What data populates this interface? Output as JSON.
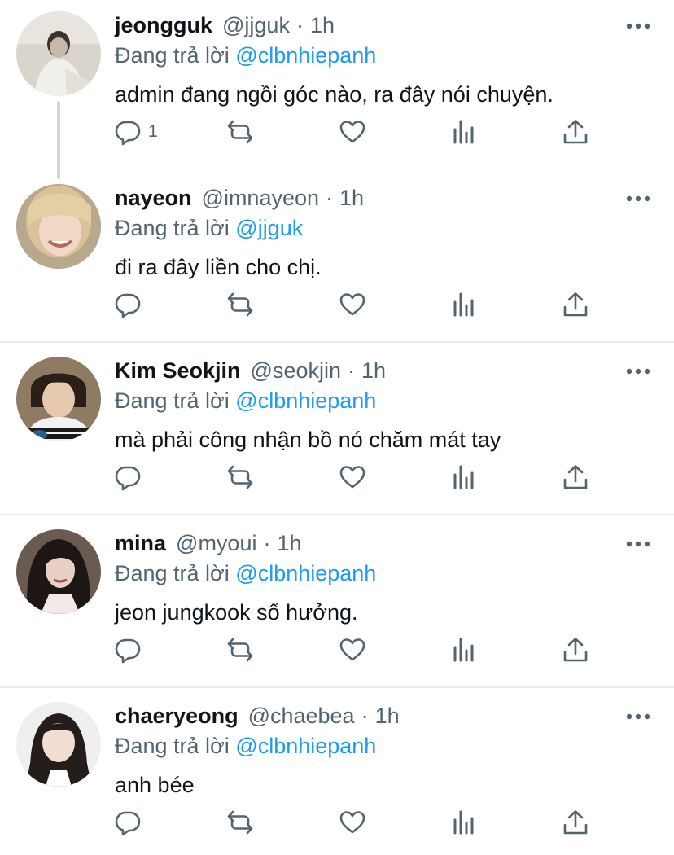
{
  "reply_prefix": "Đang trả lời",
  "colors": {
    "accent": "#1d9bf0",
    "secondary_text": "#536471",
    "primary_text": "#0f1419",
    "divider": "#e6ecf0"
  },
  "tweets": [
    {
      "name": "jeongguk",
      "handle": "@jjguk",
      "dot": "·",
      "time": "1h",
      "replying_to": "@clbnhiepanh",
      "text": "admin đang ngồi góc nào, ra đây nói chuyện.",
      "reply_count": "1",
      "avatar": "avatar-photo"
    },
    {
      "name": "nayeon",
      "handle": "@imnayeon",
      "dot": "·",
      "time": "1h",
      "replying_to": "@jjguk",
      "text": "đi ra đây liền cho chị.",
      "reply_count": "",
      "avatar": "avatar-photo"
    },
    {
      "name": "Kim Seokjin",
      "handle": "@seokjin",
      "dot": "·",
      "time": "1h",
      "replying_to": "@clbnhiepanh",
      "text": "mà phải công nhận bồ nó chăm mát tay",
      "reply_count": "",
      "avatar": "avatar-photo"
    },
    {
      "name": "mina",
      "handle": "@myoui",
      "dot": "·",
      "time": "1h",
      "replying_to": "@clbnhiepanh",
      "text": "jeon jungkook số hưởng.",
      "reply_count": "",
      "avatar": "avatar-photo"
    },
    {
      "name": "chaeryeong",
      "handle": "@chaebea",
      "dot": "·",
      "time": "1h",
      "replying_to": "@clbnhiepanh",
      "text": "anh bée",
      "reply_count": "",
      "avatar": "avatar-photo"
    }
  ],
  "icons": {
    "reply": "reply-icon",
    "retweet": "retweet-icon",
    "like": "like-icon",
    "analytics": "analytics-icon",
    "share": "share-icon",
    "more": "more-icon"
  }
}
